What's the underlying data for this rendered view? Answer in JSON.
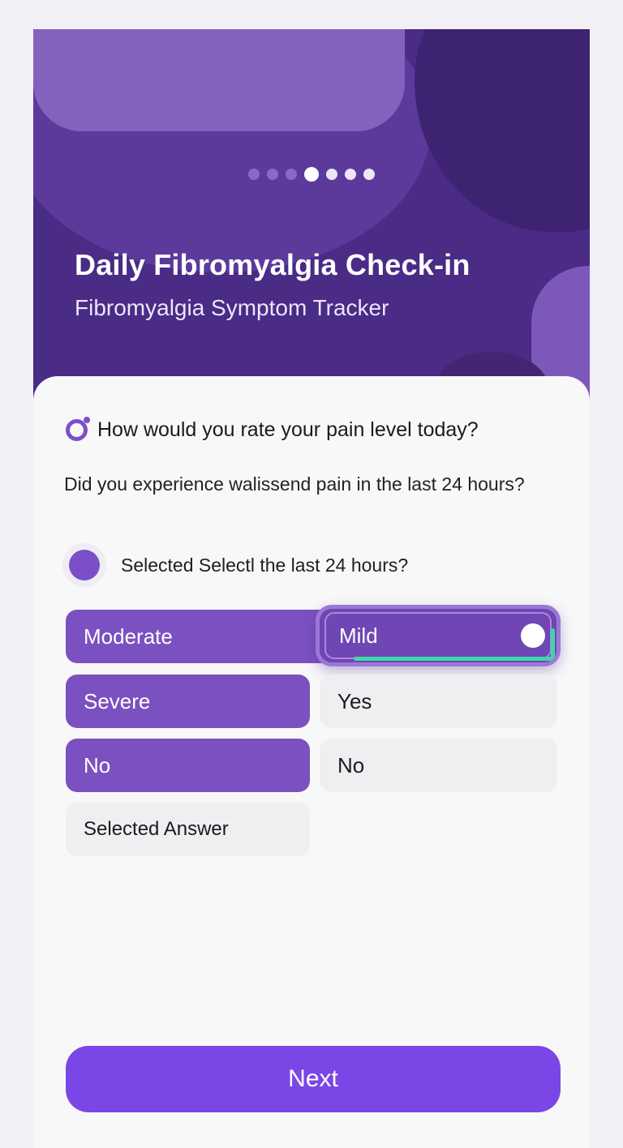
{
  "onboarding": {
    "steps_total": 7,
    "current_step": 4
  },
  "header": {
    "title": "Daily Fibromyalgia Check-in",
    "subtitle": "Fibromyalgia Symptom Tracker"
  },
  "question": {
    "main": "How would you rate your pain level today?",
    "secondary": "Did you experience walissend pain in the last 24 hours?",
    "selected_label": "Selected Selectl the last 24 hours?"
  },
  "options": {
    "moderate": "Moderate",
    "mild": "Mild",
    "severe": "Severe",
    "yes": "Yes",
    "no_left": "No",
    "no_right": "No",
    "selected_answer": "Selected Answer"
  },
  "footer": {
    "next_label": "Next"
  },
  "colors": {
    "accent": "#7b50c0",
    "button": "#7a47e6",
    "hero": "#4a2b86",
    "highlight": "#3fd8a8"
  },
  "icons": {
    "question_icon": "ring-icon"
  }
}
